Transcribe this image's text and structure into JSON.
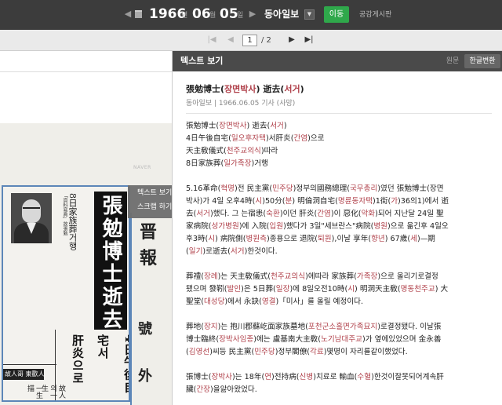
{
  "topbar": {
    "year": "1966",
    "year_unit": "년",
    "month": "06",
    "month_unit": "월",
    "day": "05",
    "day_unit": "일",
    "newspaper": "동아일보",
    "move_button": "이동",
    "public_board": "공감게시판"
  },
  "pagination": {
    "current_page": "1",
    "total": "/ 2"
  },
  "newspaper_image": {
    "watermark": "NAVER",
    "caption_vertical": "「資料寫眞」故張勉",
    "side_text": "8日家族葬거행",
    "headline": "張勉博士逝去",
    "subhead_1": "4日午後自宅서",
    "subhead_2": "肝炎으로",
    "banner": "故人哥 東歡人",
    "small_col_1": "故人의一生",
    "small_col_2": "一生描",
    "right_chars": [
      "晋",
      "報",
      "號",
      "外"
    ],
    "blue_accent": "#5c86b8"
  },
  "tooltip": {
    "item_1": "텍스트 보기",
    "item_2": "스크랩 하기"
  },
  "panel": {
    "title": "텍스트 보기",
    "toggle_original": "원문",
    "toggle_korean": "한글변환",
    "article_title_prefix": "張勉博士(",
    "article_title_reading": "장면박사",
    "article_title_mid": ") 逝去(",
    "article_title_reading2": "서거",
    "article_title_suffix": ")",
    "article_meta": "동아일보 | 1966.06.05 기사 (사망)",
    "lines": [
      "張勉博士(장면박사) 逝去(서거)",
      "4日午後自宅(일오후자택)서肝炎(간염)으로",
      "天主敎儀式(천주교의식)따라",
      "8日家族葬(일가족장)거행",
      "",
      " 5.16革命(혁명)전 民主黨(민주당)정부의國務總理(국무총리)였던 張勉博士(장면",
      "박사)가 4일 오후4時(시)50分(분) 明倫洞自宅(명륜동자택)1街(가)36의1)에서 逝",
      "去(서거)했다. 그 는宿患(숙환)이던 肝炎(간염)이 惡化(악화)되어 지난달 24일 聖",
      "家病院(성가병원)에 入院(입원)했다가 3일\"세브란스\"病院(병원)으로 옮긴후 4일오",
      "후3時(시) 病院側(병원측)종용으로 退院(퇴원),이날 享年(향년) 67歲(세)—期",
      "(일기)로逝去(서거)한것이다.",
      "",
      " 葬禮(장례)는 天主敎儀式(천주교의식)에따라 家族葬(가족장)으로 올리기로결정",
      "됐으며 發靷(발인)은 5日葬(일장)에 8일오전10時(시) 明洞天主敎(명동천주교) 大",
      "聖堂(대성당)에서 永訣(영결)「미사」를 올릴 예정이다.",
      "",
      " 葬地(장지)는 抱川郡蘇屹面家族墓地(포천군소흘면가족묘지)로결정됐다. 이날張",
      "博士臨終(장박사임종)에는 盧基南大主敎(노기남대주교)가 옆에있었으며 金永善",
      "(김영선)씨등 民主黨(민주당)정부閣僚(각료)몇명이 자리를같이했었다.",
      "",
      " 張博士(장박사)는 18年(연)전持病(신병)치료로 輸血(수혈)한것이잘못되어계속肝",
      "臟(간장)을앓아왔었다."
    ]
  }
}
